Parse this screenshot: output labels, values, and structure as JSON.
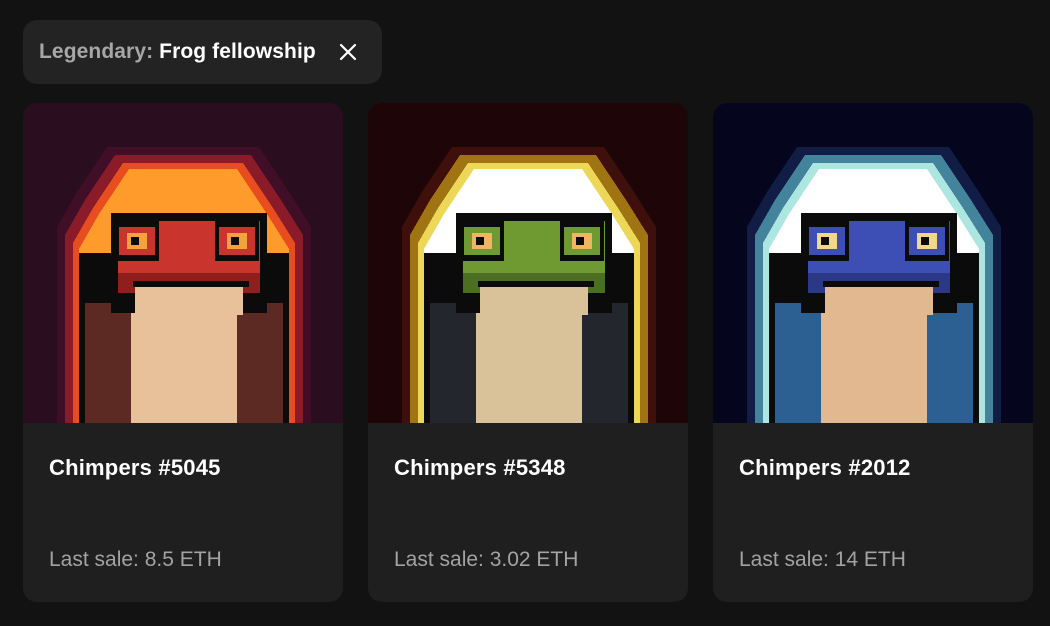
{
  "filter": {
    "label": "Legendary:",
    "value": "Frog fellowship",
    "close_icon": "close-icon"
  },
  "cards": [
    {
      "title": "Chimpers #5045",
      "sale_label": "Last sale:",
      "sale_value": "8.5 ETH",
      "sale_text": "Last sale: 8.5 ETH",
      "art": {
        "bg": "#2a0d1e",
        "glow": [
          "#ff9b2a",
          "#ff5a1e",
          "#c8262a",
          "#6b1236"
        ],
        "skin": "#c9342c",
        "skin_dark": "#8f1f1c",
        "eye": "#f2a33a",
        "robe": "#5c2a22",
        "belly": "#e8c19a"
      }
    },
    {
      "title": "Chimpers #5348",
      "sale_label": "Last sale:",
      "sale_value": "3.02 ETH",
      "sale_text": "Last sale: 3.02 ETH",
      "art": {
        "bg": "#1e0608",
        "glow": [
          "#ffffff",
          "#fff06a",
          "#f2c91c",
          "#7a2210"
        ],
        "skin": "#6f9a31",
        "skin_dark": "#4c6e22",
        "eye": "#f0b560",
        "robe": "#23262c",
        "belly": "#d9c29a"
      }
    },
    {
      "title": "Chimpers #2012",
      "sale_label": "Last sale:",
      "sale_value": "14 ETH",
      "sale_text": "Last sale: 14 ETH",
      "art": {
        "bg": "#05061e",
        "glow": [
          "#ffffff",
          "#c8fff2",
          "#6fd7e6",
          "#274a8c"
        ],
        "skin": "#3d4fb4",
        "skin_dark": "#2a3886",
        "eye": "#f3d78a",
        "robe": "#2c5f92",
        "belly": "#e1b890"
      }
    }
  ]
}
